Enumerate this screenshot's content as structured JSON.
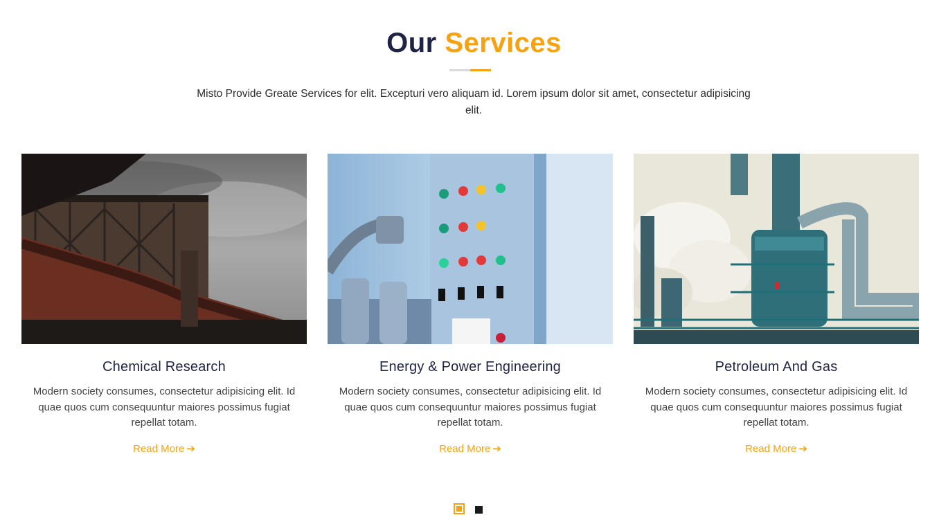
{
  "section": {
    "title_part1": "Our",
    "title_part2": "Services",
    "intro": "Misto Provide Greate Services for elit. Excepturi vero aliquam id. Lorem ipsum dolor sit amet, consectetur adipisicing elit."
  },
  "services": [
    {
      "title": "Chemical Research",
      "description": "Modern society consumes, consectetur adipisicing elit. Id quae quos cum consequuntur maiores possimus fugiat repellat totam.",
      "link_label": "Read More",
      "image_icon": "industrial-gas-tanks-photo"
    },
    {
      "title": "Energy & Power Engineering",
      "description": "Modern society consumes, consectetur adipisicing elit. Id quae quos cum consequuntur maiores possimus fugiat repellat totam.",
      "link_label": "Read More",
      "image_icon": "control-panel-photo"
    },
    {
      "title": "Petroleum And Gas",
      "description": "Modern society consumes, consectetur adipisicing elit. Id quae quos cum consequuntur maiores possimus fugiat repellat totam.",
      "link_label": "Read More",
      "image_icon": "refinery-tower-photo"
    }
  ],
  "carousel": {
    "pages": 2,
    "active_page": 1
  },
  "colors": {
    "accent": "#f5a313",
    "heading": "#1f2344"
  }
}
